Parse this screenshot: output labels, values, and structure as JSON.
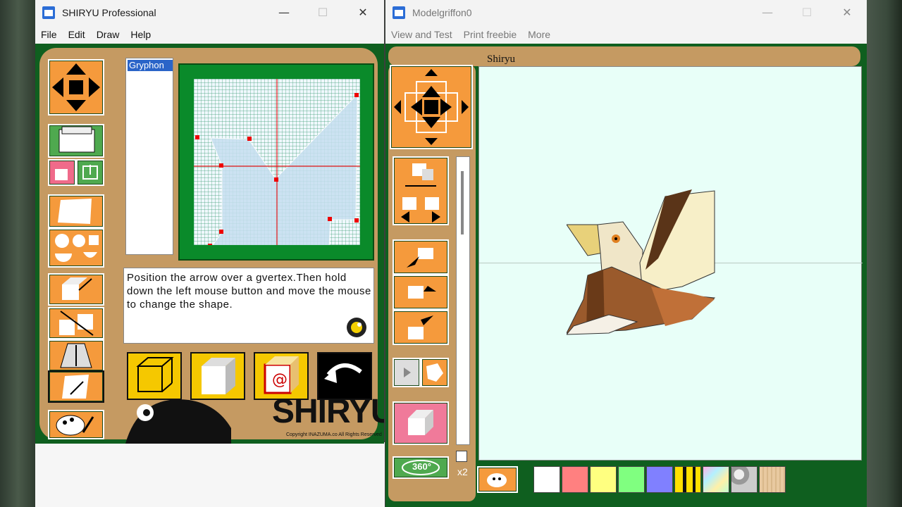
{
  "left_window": {
    "title": "SHIRYU Professional",
    "menu": [
      "File",
      "Edit",
      "Draw",
      "Help"
    ],
    "list": {
      "selected_item": "Gryphon"
    },
    "message": "Position the arrow over a gvertex.Then hold down the left mouse button and move the mouse to change the shape.",
    "brand_text": "SHIRYU",
    "copyright": "Copyright INAZUMA.co All Rights Reserved"
  },
  "right_window": {
    "title": "Modelgriffon0",
    "menu": [
      "View and Test",
      "Print freebie",
      "More"
    ],
    "view_label": "Shiryu",
    "rotate_label": "360°",
    "zoom_label": "x2",
    "swatch_colors": [
      "#ffffff",
      "#ff8080",
      "#ffff80",
      "#80ff80",
      "#8080ff"
    ]
  },
  "window_controls": {
    "minimize": "—",
    "maximize": "☐",
    "close": "✕"
  },
  "icons": [
    "app-icon",
    "dpad-icon",
    "folder-icon",
    "save-icon",
    "paper-icon",
    "shapes-icon",
    "box-icon",
    "palette-icon",
    "wireframe-icon",
    "solid-icon",
    "texture-icon",
    "undo-icon"
  ],
  "colors": {
    "panel_green": "#0f5f1f",
    "tan": "#c59a62",
    "button_orange": "#f59a3c",
    "grid_green": "#0a8a2a",
    "selection_blue": "#2a64c8"
  }
}
